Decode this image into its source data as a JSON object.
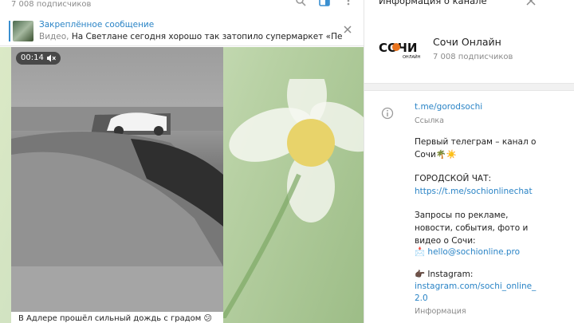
{
  "chat": {
    "subscribers_label": "7 008 подписчиков",
    "pinned": {
      "title": "Закреплённое сообщение",
      "type_label": "Видео,",
      "text": "На Светлане сегодня хорошо так затопило супермаркет «Перекр..."
    },
    "message": {
      "video_time": "00:14",
      "caption": "В Адлере прошёл сильный дождь с градом 😕"
    }
  },
  "panel": {
    "title": "Информация о канале",
    "channel_name": "Сочи Онлайн",
    "channel_subscribers": "7 008 подписчиков",
    "logo_text": "СОЧИ",
    "logo_subtext": "ОНЛАЙН",
    "link": "t.me/gorodsochi",
    "link_label": "Ссылка",
    "desc_line1": "Первый телеграм – канал о",
    "desc_line2": "Сочи🌴☀️",
    "chat_label": "ГОРОДСКОЙ ЧАТ:",
    "chat_link": "https://t.me/sochionlinechat",
    "ads_line1": "Запросы по рекламе,",
    "ads_line2": "новости, события, фото и",
    "ads_line3": "видео о Сочи:",
    "email": "📩 hello@sochionline.pro",
    "insta_label": "👉🏿 Instagram:",
    "insta_link1": "instagram.com/sochi_online_",
    "insta_link2": "2.0",
    "info_label": "Информация"
  },
  "colors": {
    "accent": "#2a84c6",
    "logo_orange": "#e8731e"
  }
}
